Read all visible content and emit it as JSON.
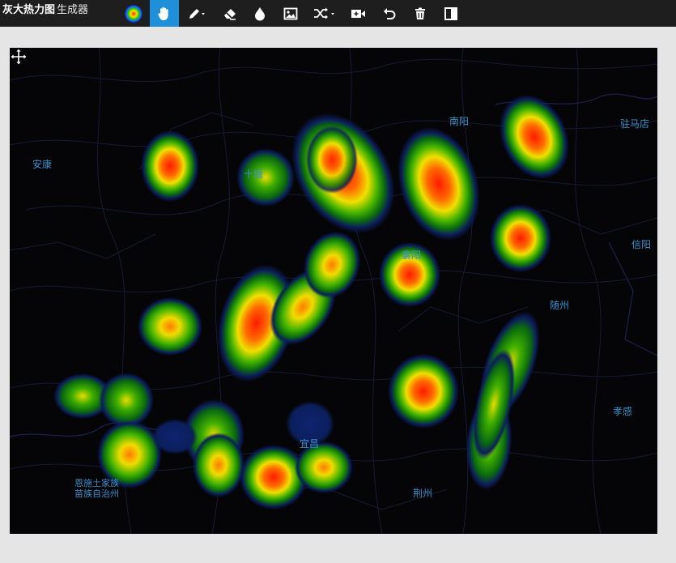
{
  "app": {
    "title_bold": "灰大热力图",
    "title_rest": "生成器"
  },
  "toolbar": {
    "tools": [
      {
        "name": "gradient-icon",
        "active": false
      },
      {
        "name": "hand-icon",
        "active": true
      },
      {
        "name": "pencil-icon",
        "active": false,
        "dropdown": true
      },
      {
        "name": "eraser-icon",
        "active": false
      },
      {
        "name": "drop-icon",
        "active": false
      },
      {
        "name": "image-icon",
        "active": false
      },
      {
        "name": "shuffle-icon",
        "active": false,
        "dropdown": true
      },
      {
        "name": "add-video-icon",
        "active": false
      },
      {
        "name": "undo-icon",
        "active": false
      },
      {
        "name": "trash-icon",
        "active": false
      },
      {
        "name": "split-view-icon",
        "active": false
      }
    ]
  },
  "map": {
    "cities": [
      {
        "key": "ankang",
        "label": "安康"
      },
      {
        "key": "shiyan",
        "label": "十堰"
      },
      {
        "key": "nanyang",
        "label": "南阳"
      },
      {
        "key": "zhumadian",
        "label": "驻马店"
      },
      {
        "key": "xinyang",
        "label": "信阳"
      },
      {
        "key": "xiangyang",
        "label": "襄阳"
      },
      {
        "key": "suizhou",
        "label": "随州"
      },
      {
        "key": "xiaogan",
        "label": "孝感"
      },
      {
        "key": "yichang",
        "label": "宜昌"
      },
      {
        "key": "jingzhou",
        "label": "荆州"
      },
      {
        "key": "enshi",
        "label": "恩施土家族\n苗族自治州"
      }
    ]
  },
  "colors": {
    "toolbar_bg": "#1e1e1e",
    "active_tool": "#1e8fd8",
    "map_bg": "#050507",
    "city_label": "#3d8fc9"
  }
}
